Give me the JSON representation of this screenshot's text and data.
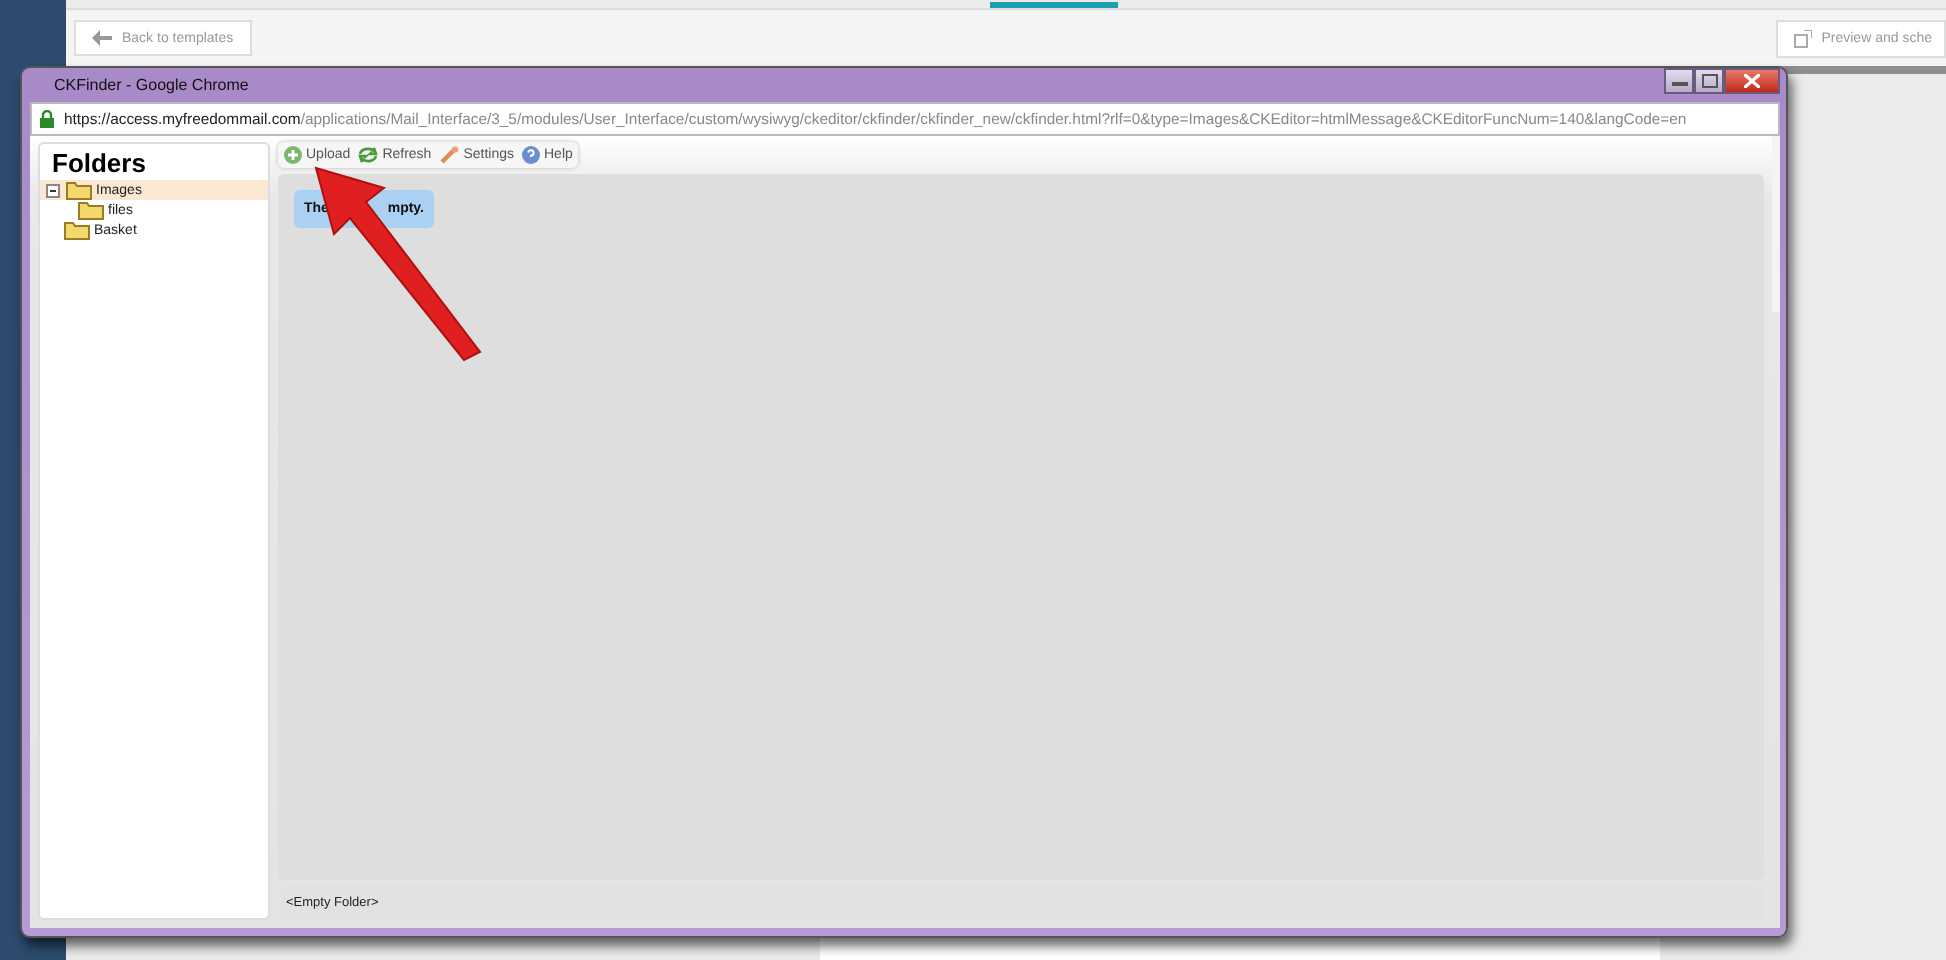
{
  "page": {
    "back_button": "Back to templates",
    "preview_button": "Preview and sche"
  },
  "window": {
    "title": "CKFinder - Google Chrome",
    "url_host": "https://access.myfreedommail.com",
    "url_path": "/applications/Mail_Interface/3_5/modules/User_Interface/custom/wysiwyg/ckeditor/ckfinder/ckfinder_new/ckfinder.html?rlf=0&type=Images&CKEditor=htmlMessage&CKEditorFuncNum=140&langCode=en"
  },
  "folders": {
    "title": "Folders",
    "items": [
      {
        "label": "Images",
        "selected": true,
        "expanded": true,
        "children": [
          {
            "label": "files",
            "selected": false
          }
        ]
      },
      {
        "label": "Basket",
        "selected": false
      }
    ]
  },
  "toolbar": [
    {
      "kind": "upload",
      "label": "Upload"
    },
    {
      "kind": "refresh",
      "label": "Refresh"
    },
    {
      "kind": "settings",
      "label": "Settings"
    },
    {
      "kind": "help",
      "label": "Help"
    }
  ],
  "message": {
    "parts": [
      "The",
      "mpty."
    ]
  },
  "status_bar": "<Empty Folder>"
}
